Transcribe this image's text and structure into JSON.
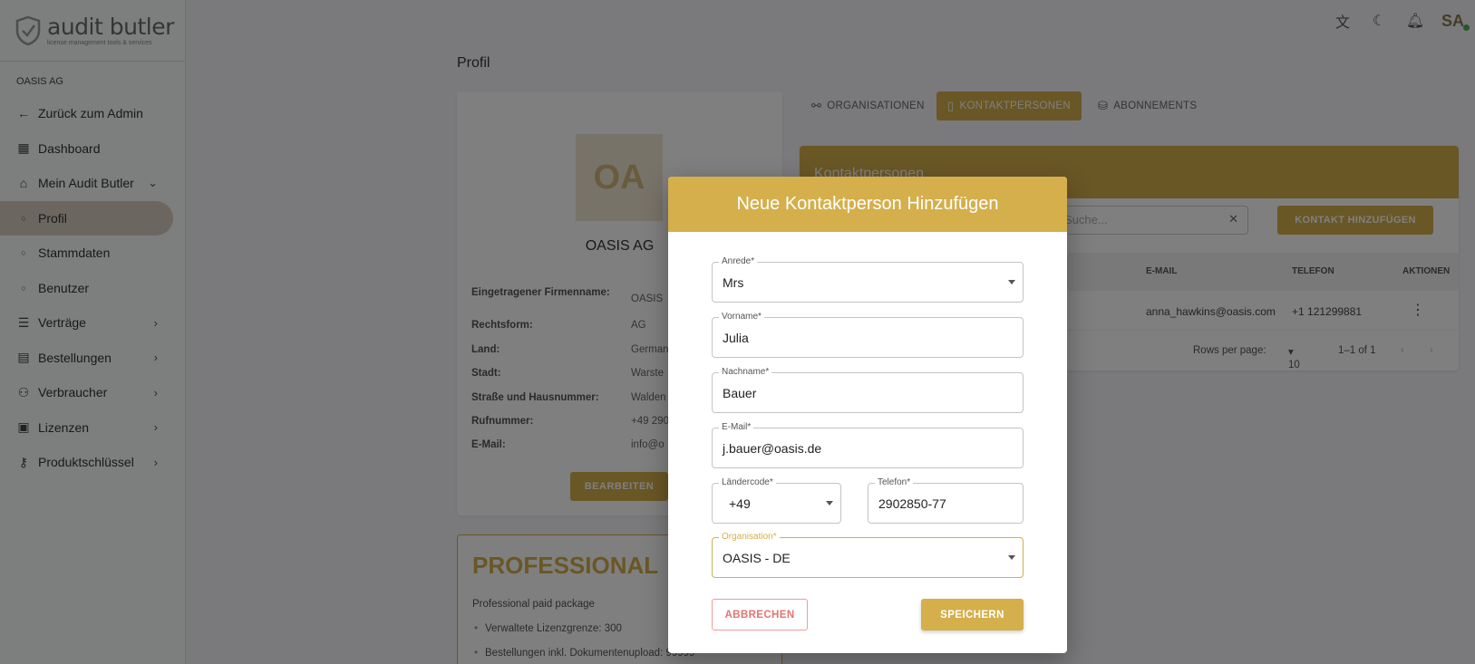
{
  "brand": {
    "name": "audit butler",
    "tagline": "license management tools & services",
    "accent": "#d4af4c"
  },
  "sidebar": {
    "org_label": "OASIS AG",
    "items": [
      {
        "label": "Zurück zum Admin",
        "icon": "arrow-left-icon"
      },
      {
        "label": "Dashboard",
        "icon": "dashboard-icon"
      },
      {
        "label": "Mein Audit Butler",
        "icon": "home-icon"
      },
      {
        "label": "Profil",
        "icon": "circle-icon"
      },
      {
        "label": "Stammdaten",
        "icon": "circle-icon"
      },
      {
        "label": "Benutzer",
        "icon": "circle-icon"
      },
      {
        "label": "Verträge",
        "icon": "list-icon"
      },
      {
        "label": "Bestellungen",
        "icon": "document-icon"
      },
      {
        "label": "Verbraucher",
        "icon": "users-icon"
      },
      {
        "label": "Lizenzen",
        "icon": "license-icon"
      },
      {
        "label": "Produktschlüssel",
        "icon": "key-icon"
      }
    ]
  },
  "topbar": {
    "avatar_initials": "SA"
  },
  "page": {
    "title": "Profil"
  },
  "profile": {
    "initials": "OA",
    "name": "OASIS AG",
    "fields": [
      {
        "key": "Eingetragener Firmenname:",
        "value": "OASIS"
      },
      {
        "key": "Rechtsform:",
        "value": "AG"
      },
      {
        "key": "Land:",
        "value": "German"
      },
      {
        "key": "Stadt:",
        "value": "Warste"
      },
      {
        "key": "Straße und Hausnummer:",
        "value": "Walden"
      },
      {
        "key": "Rufnummer:",
        "value": "+49 290"
      },
      {
        "key": "E-Mail:",
        "value": "info@o"
      }
    ],
    "edit_label": "BEARBEITEN"
  },
  "plan": {
    "title": "PROFESSIONAL",
    "description": "Professional paid package",
    "items": [
      "Verwaltete Lizenzgrenze: 300",
      "Bestellungen inkl. Dokumentenupload: 99999"
    ]
  },
  "tabs": [
    {
      "label": "ORGANISATIONEN",
      "icon": "organisation-icon"
    },
    {
      "label": "KONTAKTPERSONEN",
      "icon": "contact-book-icon"
    },
    {
      "label": "ABONNEMENTS",
      "icon": "subscription-icon"
    }
  ],
  "contacts": {
    "title": "Kontaktpersonen",
    "search_placeholder": "Suche...",
    "add_label": "KONTAKT HINZUFÜGEN",
    "columns": {
      "email": "E-MAIL",
      "phone": "TELEFON",
      "actions": "AKTIONEN"
    },
    "rows": [
      {
        "email": "anna_hawkins@oasis.com",
        "phone": "+1 121299881"
      }
    ],
    "pagination": {
      "rows_label": "Rows per page:",
      "rows_value": "10",
      "range": "1–1 of 1"
    }
  },
  "dialog": {
    "title": "Neue Kontaktperson Hinzufügen",
    "fields": {
      "salutation": {
        "label": "Anrede*",
        "value": "Mrs"
      },
      "first_name": {
        "label": "Vorname*",
        "value": "Julia"
      },
      "last_name": {
        "label": "Nachname*",
        "value": "Bauer"
      },
      "email": {
        "label": "E-Mail*",
        "value": "j.bauer@oasis.de"
      },
      "country_code": {
        "label": "Ländercode*",
        "value": "+49"
      },
      "phone": {
        "label": "Telefon*",
        "value": "2902850-77"
      },
      "organisation": {
        "label": "Organisation*",
        "value": "OASIS - DE"
      }
    },
    "cancel_label": "ABBRECHEN",
    "save_label": "SPEICHERN"
  }
}
